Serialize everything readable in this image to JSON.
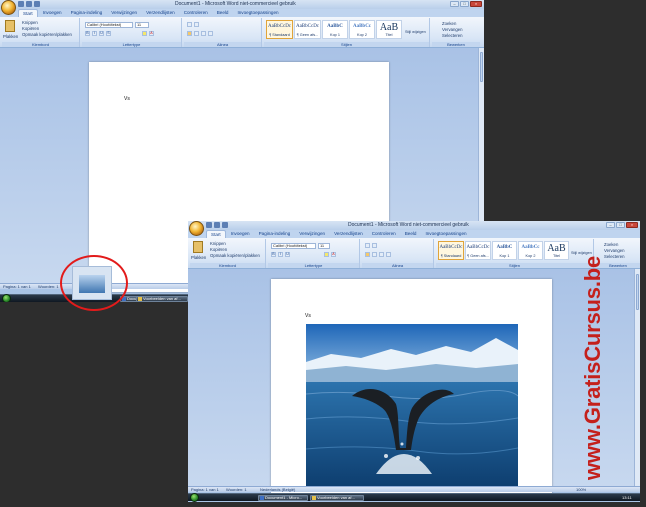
{
  "back_window": {
    "title": "Document1 - Microsoft Word niet-commercieel gebruik",
    "tabs": [
      "Start",
      "Invoegen",
      "Pagina-indeling",
      "Verwijzingen",
      "Verzendlijsten",
      "Controleren",
      "Beeld",
      "Invoegtoepassingen"
    ],
    "clipboard": {
      "paste": "Plakken",
      "cut": "Knippen",
      "copy": "Kopiëren",
      "format_painter": "Opmaak kopiëren/plakken",
      "label": "Klembord"
    },
    "font": {
      "name": "Calibri (Hoofdtekst)",
      "size": "11",
      "label": "Lettertype"
    },
    "paragraph_label": "Alinea",
    "styles": [
      {
        "sample": "AaBbCcDc",
        "name": "¶ Standaard"
      },
      {
        "sample": "AaBbCcDc",
        "name": "¶ Geen afs..."
      },
      {
        "sample": "AaBbC",
        "name": "Kop 1"
      },
      {
        "sample": "AaBbCc",
        "name": "Kop 2"
      },
      {
        "sample": "AaB",
        "name": "Titel"
      }
    ],
    "styles_label": "Stijlen",
    "change_styles": "Stijl wijzigen",
    "editing": {
      "find": "Zoeken",
      "replace": "Vervangen",
      "select": "Selecteren",
      "label": "Bewerken"
    },
    "page_text": "Vs",
    "status": {
      "page": "Pagina: 1 van 1",
      "words": "Woorden: 1"
    }
  },
  "front_window": {
    "title": "Document1 - Microsoft Word niet-commercieel gebruik",
    "tabs": [
      "Start",
      "Invoegen",
      "Pagina-indeling",
      "Verwijzingen",
      "Verzendlijsten",
      "Controleren",
      "Beeld",
      "Invoegtoepassingen"
    ],
    "clipboard": {
      "paste": "Plakken",
      "cut": "Knippen",
      "copy": "Kopiëren",
      "format_painter": "Opmaak kopiëren/plakken",
      "label": "Klembord"
    },
    "font": {
      "name": "Calibri (Hoofdtekst)",
      "size": "11",
      "label": "Lettertype"
    },
    "paragraph_label": "Alinea",
    "styles": [
      {
        "sample": "AaBbCcDc",
        "name": "¶ Standaard"
      },
      {
        "sample": "AaBbCcDc",
        "name": "¶ Geen afs..."
      },
      {
        "sample": "AaBbC",
        "name": "Kop 1"
      },
      {
        "sample": "AaBbCc",
        "name": "Kop 2"
      },
      {
        "sample": "AaB",
        "name": "Titel"
      }
    ],
    "styles_label": "Stijlen",
    "change_styles": "Stijl wijzigen",
    "editing": {
      "find": "Zoeken",
      "replace": "Vervangen",
      "select": "Selecteren",
      "label": "Bewerken"
    },
    "page_text": "Vs",
    "status": {
      "page": "Pagina: 1 van 1",
      "words": "Woorden: 1",
      "lang": "Nederlands (België)",
      "zoom": "100%"
    },
    "taskbar": {
      "item1": "Document1 - Micro...",
      "item2": "Voorbeelden van af...",
      "time": "13:11"
    }
  },
  "back_taskbar": {
    "item1": "Document1 - Micro...",
    "item2": "Voorbeelden van af..."
  },
  "watermark": "www.GratisCursus.be",
  "colors": {
    "accent_red": "#e21b1b",
    "watermark": "#c4201c",
    "ribbon_blue": "#15428b"
  }
}
